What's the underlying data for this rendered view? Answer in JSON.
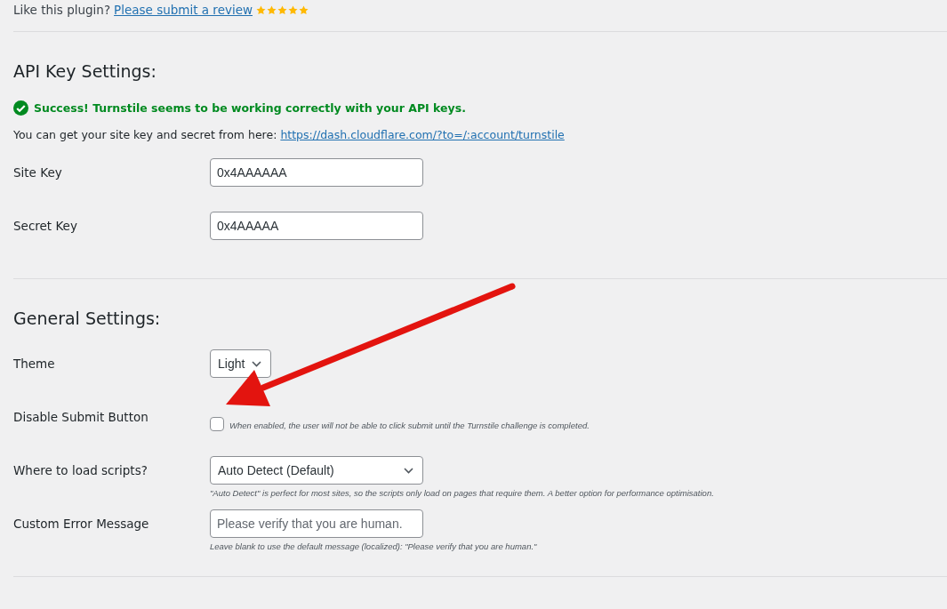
{
  "review": {
    "prompt": "Like this plugin?",
    "link": "Please submit a review",
    "stars": 5
  },
  "sections": [
    {
      "title": "API Key Settings:",
      "notice": {
        "kind": "success",
        "text": "Success! Turnstile seems to be working correctly with your API keys."
      },
      "intro": {
        "text": "You can get your site key and secret from here:",
        "link": "https://dash.cloudflare.com/?to=/:account/turnstile"
      },
      "fields": [
        {
          "kind": "text",
          "label": "Site Key",
          "value": "0x4AAAAAA"
        },
        {
          "kind": "text",
          "label": "Secret Key",
          "value": "0x4AAAAA"
        }
      ]
    },
    {
      "title": "General Settings:",
      "fields": [
        {
          "kind": "select",
          "label": "Theme",
          "value": "Light"
        },
        {
          "kind": "checkbox",
          "label": "Disable Submit Button",
          "checked": false,
          "description": "When enabled, the user will not be able to click submit until the Turnstile challenge is completed."
        },
        {
          "kind": "select",
          "label": "Where to load scripts?",
          "value": "Auto Detect (Default)",
          "description": "\"Auto Detect\" is perfect for most sites, so the scripts only load on pages that require them. A better option for performance optimisation."
        },
        {
          "kind": "text",
          "label": "Custom Error Message",
          "placeholder": "Please verify that you are human.",
          "description": "Leave blank to use the default message (localized): \"Please verify that you are human.\""
        }
      ]
    }
  ]
}
